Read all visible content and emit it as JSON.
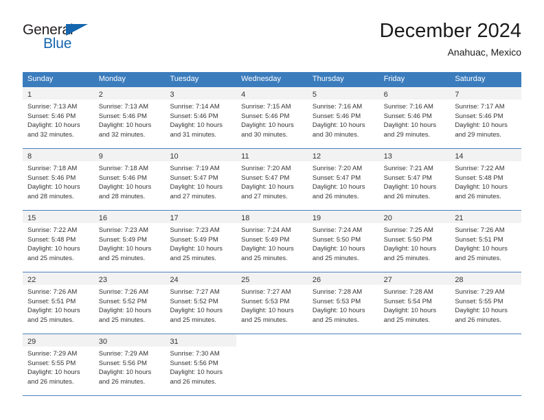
{
  "brand": {
    "name_part1": "General",
    "name_part2": "Blue",
    "accent_color": "#1566ae"
  },
  "header": {
    "title": "December 2024",
    "subtitle": "Anahuac, Mexico"
  },
  "calendar": {
    "header_background": "#3b7cbd",
    "daynum_background": "#f2f2f2",
    "weekday_headers": [
      "Sunday",
      "Monday",
      "Tuesday",
      "Wednesday",
      "Thursday",
      "Friday",
      "Saturday"
    ],
    "weeks": [
      [
        {
          "day": "1",
          "sunrise": "Sunrise: 7:13 AM",
          "sunset": "Sunset: 5:46 PM",
          "daylight1": "Daylight: 10 hours",
          "daylight2": "and 32 minutes."
        },
        {
          "day": "2",
          "sunrise": "Sunrise: 7:13 AM",
          "sunset": "Sunset: 5:46 PM",
          "daylight1": "Daylight: 10 hours",
          "daylight2": "and 32 minutes."
        },
        {
          "day": "3",
          "sunrise": "Sunrise: 7:14 AM",
          "sunset": "Sunset: 5:46 PM",
          "daylight1": "Daylight: 10 hours",
          "daylight2": "and 31 minutes."
        },
        {
          "day": "4",
          "sunrise": "Sunrise: 7:15 AM",
          "sunset": "Sunset: 5:46 PM",
          "daylight1": "Daylight: 10 hours",
          "daylight2": "and 30 minutes."
        },
        {
          "day": "5",
          "sunrise": "Sunrise: 7:16 AM",
          "sunset": "Sunset: 5:46 PM",
          "daylight1": "Daylight: 10 hours",
          "daylight2": "and 30 minutes."
        },
        {
          "day": "6",
          "sunrise": "Sunrise: 7:16 AM",
          "sunset": "Sunset: 5:46 PM",
          "daylight1": "Daylight: 10 hours",
          "daylight2": "and 29 minutes."
        },
        {
          "day": "7",
          "sunrise": "Sunrise: 7:17 AM",
          "sunset": "Sunset: 5:46 PM",
          "daylight1": "Daylight: 10 hours",
          "daylight2": "and 29 minutes."
        }
      ],
      [
        {
          "day": "8",
          "sunrise": "Sunrise: 7:18 AM",
          "sunset": "Sunset: 5:46 PM",
          "daylight1": "Daylight: 10 hours",
          "daylight2": "and 28 minutes."
        },
        {
          "day": "9",
          "sunrise": "Sunrise: 7:18 AM",
          "sunset": "Sunset: 5:46 PM",
          "daylight1": "Daylight: 10 hours",
          "daylight2": "and 28 minutes."
        },
        {
          "day": "10",
          "sunrise": "Sunrise: 7:19 AM",
          "sunset": "Sunset: 5:47 PM",
          "daylight1": "Daylight: 10 hours",
          "daylight2": "and 27 minutes."
        },
        {
          "day": "11",
          "sunrise": "Sunrise: 7:20 AM",
          "sunset": "Sunset: 5:47 PM",
          "daylight1": "Daylight: 10 hours",
          "daylight2": "and 27 minutes."
        },
        {
          "day": "12",
          "sunrise": "Sunrise: 7:20 AM",
          "sunset": "Sunset: 5:47 PM",
          "daylight1": "Daylight: 10 hours",
          "daylight2": "and 26 minutes."
        },
        {
          "day": "13",
          "sunrise": "Sunrise: 7:21 AM",
          "sunset": "Sunset: 5:47 PM",
          "daylight1": "Daylight: 10 hours",
          "daylight2": "and 26 minutes."
        },
        {
          "day": "14",
          "sunrise": "Sunrise: 7:22 AM",
          "sunset": "Sunset: 5:48 PM",
          "daylight1": "Daylight: 10 hours",
          "daylight2": "and 26 minutes."
        }
      ],
      [
        {
          "day": "15",
          "sunrise": "Sunrise: 7:22 AM",
          "sunset": "Sunset: 5:48 PM",
          "daylight1": "Daylight: 10 hours",
          "daylight2": "and 25 minutes."
        },
        {
          "day": "16",
          "sunrise": "Sunrise: 7:23 AM",
          "sunset": "Sunset: 5:49 PM",
          "daylight1": "Daylight: 10 hours",
          "daylight2": "and 25 minutes."
        },
        {
          "day": "17",
          "sunrise": "Sunrise: 7:23 AM",
          "sunset": "Sunset: 5:49 PM",
          "daylight1": "Daylight: 10 hours",
          "daylight2": "and 25 minutes."
        },
        {
          "day": "18",
          "sunrise": "Sunrise: 7:24 AM",
          "sunset": "Sunset: 5:49 PM",
          "daylight1": "Daylight: 10 hours",
          "daylight2": "and 25 minutes."
        },
        {
          "day": "19",
          "sunrise": "Sunrise: 7:24 AM",
          "sunset": "Sunset: 5:50 PM",
          "daylight1": "Daylight: 10 hours",
          "daylight2": "and 25 minutes."
        },
        {
          "day": "20",
          "sunrise": "Sunrise: 7:25 AM",
          "sunset": "Sunset: 5:50 PM",
          "daylight1": "Daylight: 10 hours",
          "daylight2": "and 25 minutes."
        },
        {
          "day": "21",
          "sunrise": "Sunrise: 7:26 AM",
          "sunset": "Sunset: 5:51 PM",
          "daylight1": "Daylight: 10 hours",
          "daylight2": "and 25 minutes."
        }
      ],
      [
        {
          "day": "22",
          "sunrise": "Sunrise: 7:26 AM",
          "sunset": "Sunset: 5:51 PM",
          "daylight1": "Daylight: 10 hours",
          "daylight2": "and 25 minutes."
        },
        {
          "day": "23",
          "sunrise": "Sunrise: 7:26 AM",
          "sunset": "Sunset: 5:52 PM",
          "daylight1": "Daylight: 10 hours",
          "daylight2": "and 25 minutes."
        },
        {
          "day": "24",
          "sunrise": "Sunrise: 7:27 AM",
          "sunset": "Sunset: 5:52 PM",
          "daylight1": "Daylight: 10 hours",
          "daylight2": "and 25 minutes."
        },
        {
          "day": "25",
          "sunrise": "Sunrise: 7:27 AM",
          "sunset": "Sunset: 5:53 PM",
          "daylight1": "Daylight: 10 hours",
          "daylight2": "and 25 minutes."
        },
        {
          "day": "26",
          "sunrise": "Sunrise: 7:28 AM",
          "sunset": "Sunset: 5:53 PM",
          "daylight1": "Daylight: 10 hours",
          "daylight2": "and 25 minutes."
        },
        {
          "day": "27",
          "sunrise": "Sunrise: 7:28 AM",
          "sunset": "Sunset: 5:54 PM",
          "daylight1": "Daylight: 10 hours",
          "daylight2": "and 25 minutes."
        },
        {
          "day": "28",
          "sunrise": "Sunrise: 7:29 AM",
          "sunset": "Sunset: 5:55 PM",
          "daylight1": "Daylight: 10 hours",
          "daylight2": "and 26 minutes."
        }
      ],
      [
        {
          "day": "29",
          "sunrise": "Sunrise: 7:29 AM",
          "sunset": "Sunset: 5:55 PM",
          "daylight1": "Daylight: 10 hours",
          "daylight2": "and 26 minutes."
        },
        {
          "day": "30",
          "sunrise": "Sunrise: 7:29 AM",
          "sunset": "Sunset: 5:56 PM",
          "daylight1": "Daylight: 10 hours",
          "daylight2": "and 26 minutes."
        },
        {
          "day": "31",
          "sunrise": "Sunrise: 7:30 AM",
          "sunset": "Sunset: 5:56 PM",
          "daylight1": "Daylight: 10 hours",
          "daylight2": "and 26 minutes."
        },
        {
          "day": "",
          "sunrise": "",
          "sunset": "",
          "daylight1": "",
          "daylight2": ""
        },
        {
          "day": "",
          "sunrise": "",
          "sunset": "",
          "daylight1": "",
          "daylight2": ""
        },
        {
          "day": "",
          "sunrise": "",
          "sunset": "",
          "daylight1": "",
          "daylight2": ""
        },
        {
          "day": "",
          "sunrise": "",
          "sunset": "",
          "daylight1": "",
          "daylight2": ""
        }
      ]
    ]
  }
}
